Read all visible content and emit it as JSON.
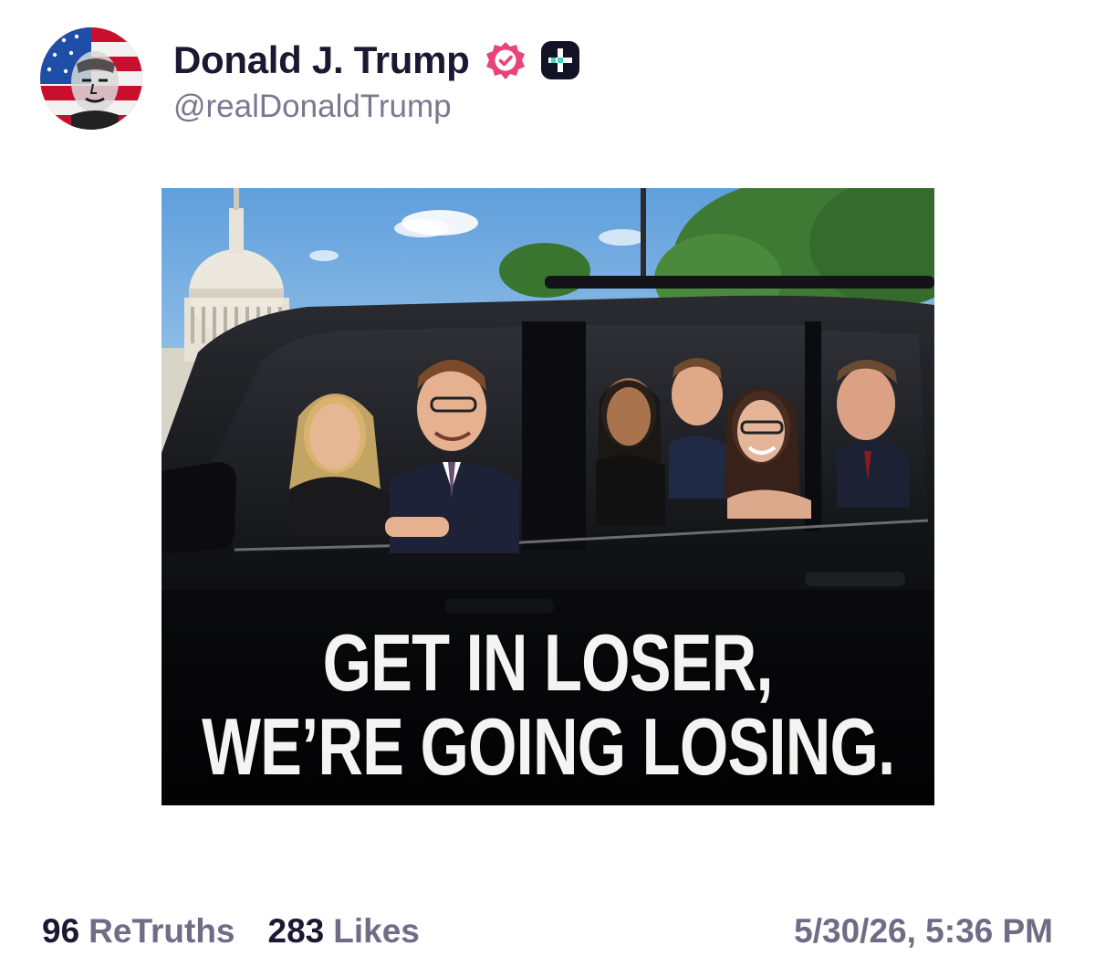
{
  "author": {
    "display_name": "Donald J. Trump",
    "handle": "@realDonaldTrump",
    "verified": true,
    "avatar_icon": "flag-portrait-avatar",
    "badge_colors": {
      "verified": "#e8437a",
      "plus": "#141225",
      "plus_accent": "#3ed9c0"
    }
  },
  "media": {
    "caption_lines": [
      "GET IN LOSER,",
      "WE’RE GOING LOSING."
    ]
  },
  "stats": {
    "retruths_count": "96",
    "retruths_label": "ReTruths",
    "likes_count": "283",
    "likes_label": "Likes"
  },
  "timestamp": "5/30/26, 5:36 PM"
}
